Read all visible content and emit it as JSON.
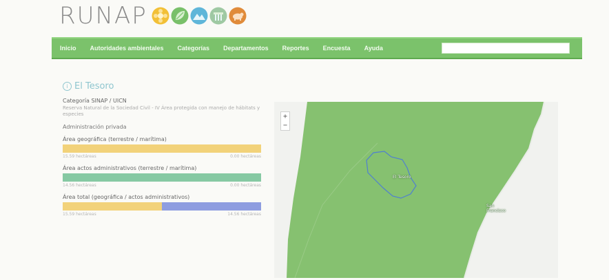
{
  "logo": {
    "text": "RUNAP",
    "icons": [
      {
        "name": "flower-icon",
        "color": "#f2c037"
      },
      {
        "name": "leaf-icon",
        "color": "#79c06a"
      },
      {
        "name": "mountain-icon",
        "color": "#5fb6d9"
      },
      {
        "name": "waterfall-icon",
        "color": "#9fc9a3"
      },
      {
        "name": "bear-icon",
        "color": "#e08b3a"
      }
    ]
  },
  "nav": {
    "items": [
      "Inicio",
      "Autoridades ambientales",
      "Categorías",
      "Departamentos",
      "Reportes",
      "Encuesta",
      "Ayuda"
    ],
    "search_placeholder": ""
  },
  "page": {
    "title": "El Tesoro",
    "info_icon": "info-icon"
  },
  "details": {
    "category_label": "Categoría SINAP / UICN",
    "category_desc": "Reserva Natural de la Sociedad Civil - IV Área protegida con manejo de hábitats y especies",
    "admin": "Administración privada",
    "geo_label": "Área geográfica (terrestre / marítima)",
    "geo_left": "15.59 hectáreas",
    "geo_right": "0.00 hectáreas",
    "adm_label": "Área actos administrativos (terrestre / marítima)",
    "adm_left": "14.56 hectáreas",
    "adm_right": "0.00 hectáreas",
    "total_label": "Área total (geográfica / actos administrativos)",
    "total_left": "15.59 hectáreas",
    "total_right": "14.56 hectáreas"
  },
  "bars": {
    "geo": [
      {
        "fraction": 1.0,
        "color": "#f2d27a"
      }
    ],
    "adm": [
      {
        "fraction": 1.0,
        "color": "#86c9a3"
      }
    ],
    "total": [
      {
        "fraction": 0.5,
        "color": "#f2d27a"
      },
      {
        "fraction": 0.5,
        "color": "#8e9de0"
      }
    ]
  },
  "map": {
    "zoom_in": "+",
    "zoom_out": "−",
    "area_label": "El Tesoro",
    "town_label": "San Francisco"
  },
  "colors": {
    "nav": "#7bc26b",
    "title": "#8fc6cf",
    "map_green": "#86c170",
    "outline": "#4f7fd1"
  }
}
